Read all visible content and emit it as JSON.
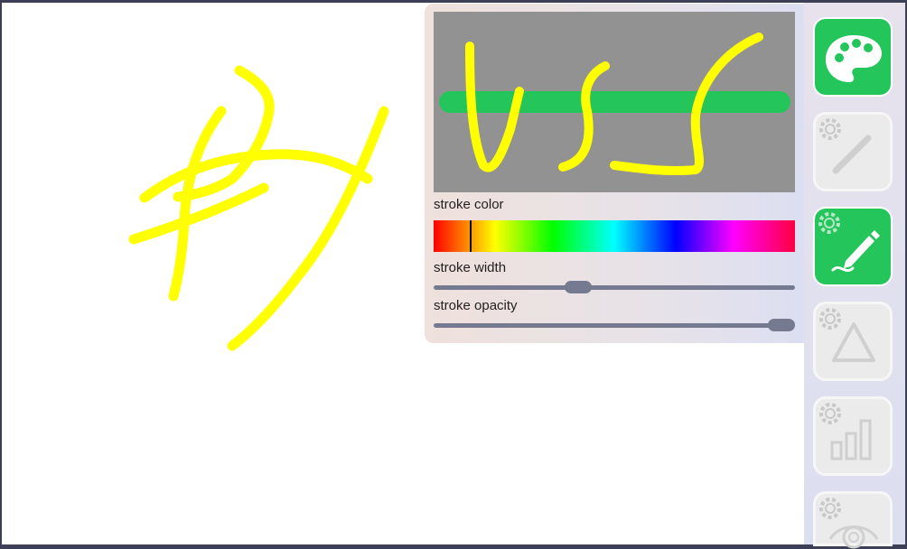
{
  "panel": {
    "stroke_color_label": "stroke color",
    "stroke_width_label": "stroke width",
    "stroke_opacity_label": "stroke opacity",
    "stroke_color_hue_position": 0.1,
    "stroke_width_value": 0.4,
    "stroke_opacity_value": 1.0
  },
  "colors": {
    "stroke": "#ffff00",
    "accent": "#24c55b",
    "preview_bg": "#929292",
    "slider": "#757a90"
  },
  "tools": [
    {
      "name": "palette-icon",
      "active": true
    },
    {
      "name": "line-icon",
      "active": false
    },
    {
      "name": "pen-icon",
      "active": true
    },
    {
      "name": "triangle-icon",
      "active": false
    },
    {
      "name": "bar-chart-icon",
      "active": false
    },
    {
      "name": "eye-icon",
      "active": false
    }
  ]
}
